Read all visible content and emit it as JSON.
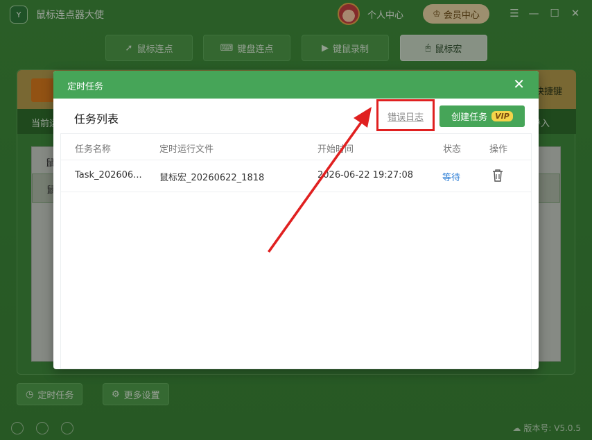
{
  "app": {
    "title": "鼠标连点器大使",
    "logo_text": "Y",
    "personal_center": "个人中心",
    "vip_center": "会员中心",
    "window_controls": [
      "menu-icon",
      "minimize-icon",
      "maximize-icon",
      "close-icon"
    ],
    "tabs": [
      {
        "label": "鼠标连点",
        "icon": "cursor-icon",
        "active": false
      },
      {
        "label": "键盘连点",
        "icon": "keyboard-icon",
        "active": false
      },
      {
        "label": "键鼠录制",
        "icon": "record-icon",
        "active": false
      },
      {
        "label": "鼠标宏",
        "icon": "mouse-icon",
        "active": true
      }
    ],
    "panel": {
      "shortcut_label": "快捷键",
      "current_label": "当前运",
      "import_label": "导入",
      "list_row_1": "鼠",
      "list_row_2": "鼠"
    },
    "bottom_buttons": [
      {
        "label": "定时任务",
        "icon": "clock-icon"
      },
      {
        "label": "更多设置",
        "icon": "gear-icon"
      }
    ],
    "status_icons": [
      "globe-icon",
      "support-icon",
      "refresh-icon"
    ],
    "version": "版本号: V5.0.5"
  },
  "dialog": {
    "title": "定时任务",
    "list_title": "任务列表",
    "error_log": "错误日志",
    "create_task": "创建任务",
    "vip_badge": "VIP",
    "columns": [
      "任务名称",
      "定时运行文件",
      "开始时间",
      "状态",
      "操作"
    ],
    "rows": [
      {
        "name": "Task_202606...",
        "file": "鼠标宏_20260622_1818",
        "start_time": "2026-06-22 19:27:08",
        "status": "等待",
        "action_icon": "trash-icon"
      }
    ]
  },
  "colors": {
    "brand_green": "#46a558",
    "status_blue": "#2f7fd6",
    "annotation_red": "#e02020",
    "vip_gold": "#f4d34a"
  }
}
